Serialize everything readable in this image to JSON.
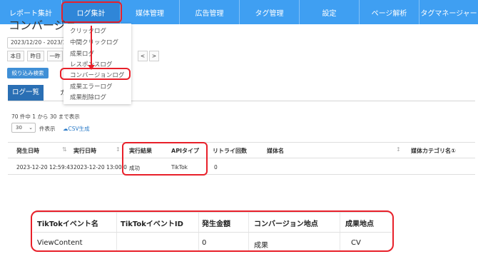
{
  "nav": {
    "items": [
      {
        "label": "レポート集計",
        "active": false
      },
      {
        "label": "ログ集計",
        "active": true
      },
      {
        "label": "媒体管理",
        "active": false
      },
      {
        "label": "広告管理",
        "active": false
      },
      {
        "label": "タグ管理",
        "active": false
      },
      {
        "label": "設定",
        "active": false
      },
      {
        "label": "ページ解析",
        "active": false
      },
      {
        "label": "タグマネージャー",
        "active": false
      }
    ]
  },
  "page": {
    "title": "コンバージョ"
  },
  "filters": {
    "date_range": "2023/12/20 - 2023/12",
    "quick": [
      "本日",
      "昨日",
      "一昨",
      "<",
      ">"
    ],
    "filter_button": "絞り込み検索"
  },
  "tabs": {
    "active": "ログ一覧",
    "other": "カ"
  },
  "dropdown": {
    "items": [
      "クリックログ",
      "中間クリックログ",
      "成果ログ",
      "レスポンスログ",
      "コンバージョンログ",
      "成果エラーログ",
      "成果削除ログ"
    ],
    "highlighted_index": 4
  },
  "list": {
    "info": "70 件中 1 から 30 まで表示",
    "per_page": "30",
    "per_page_label": "件表示",
    "csv_label": "CSV生成",
    "headers": [
      "発生日時",
      "実行日時",
      "実行結果",
      "APIタイプ",
      "リトライ回数",
      "媒体名",
      "媒体カテゴリ名①"
    ],
    "row": [
      "2023-12-20 12:59:43",
      "2023-12-20 13:00:0",
      "成功",
      "TikTok",
      "0",
      "",
      ""
    ]
  },
  "detail": {
    "headers": [
      "TikTokイベント名",
      "TikTokイベントID",
      "発生金額",
      "コンバージョン地点",
      "成果地点"
    ],
    "row": [
      "ViewContent",
      "",
      "0",
      "成果",
      "CV"
    ]
  },
  "colors": {
    "nav_bg": "#3f9ff2",
    "highlight": "#e8202a",
    "primary_button": "#3f8fd6",
    "active_tab": "#2a6fb4",
    "link": "#2b7bc8"
  }
}
